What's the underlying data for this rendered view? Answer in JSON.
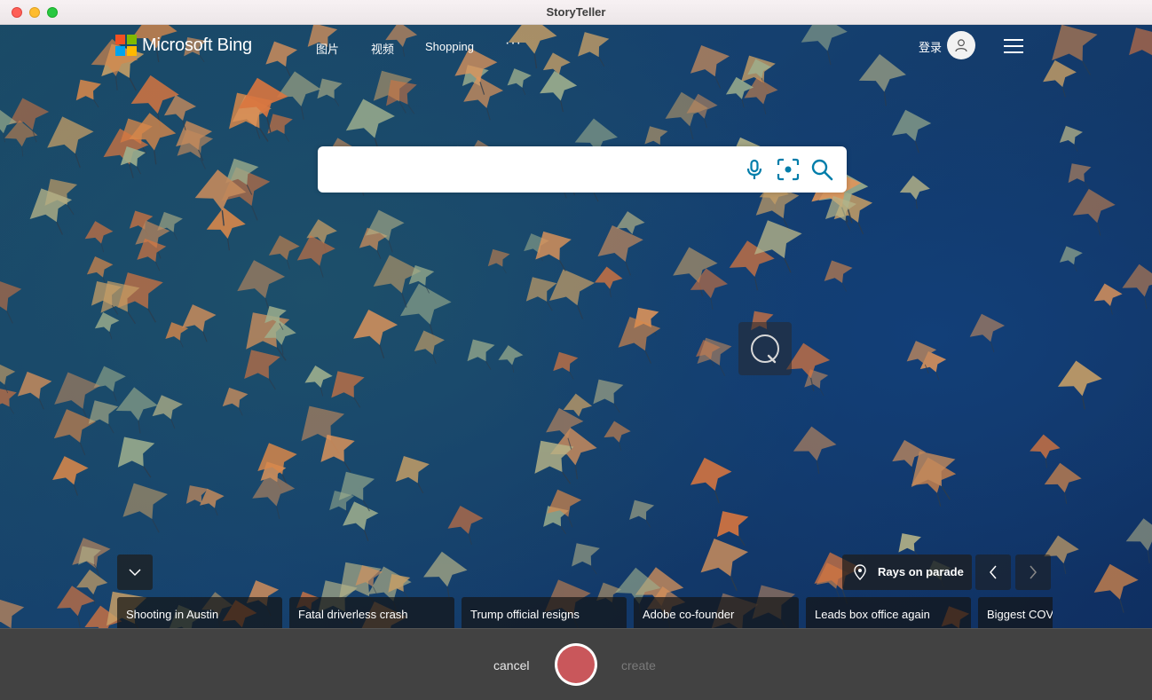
{
  "window": {
    "title": "StoryTeller"
  },
  "bing": {
    "logo_text": "Microsoft Bing",
    "logo_colors": [
      "#f25022",
      "#7fba00",
      "#00a4ef",
      "#ffb900"
    ],
    "nav": [
      {
        "label": "图片"
      },
      {
        "label": "视频"
      },
      {
        "label": "Shopping"
      }
    ],
    "nav_more": "···",
    "signin_label": "登录",
    "search": {
      "value": "",
      "placeholder": "",
      "icon_color": "#007daa"
    },
    "image_caption": "Rays on parade",
    "news": [
      {
        "label": "Shooting in Austin"
      },
      {
        "label": "Fatal driverless crash"
      },
      {
        "label": "Trump official resigns"
      },
      {
        "label": "Adobe co-founder"
      },
      {
        "label": "Leads box office again"
      },
      {
        "label": "Biggest COVID"
      }
    ]
  },
  "recorder": {
    "cancel_label": "cancel",
    "create_label": "create",
    "record_color": "#c9575b"
  }
}
